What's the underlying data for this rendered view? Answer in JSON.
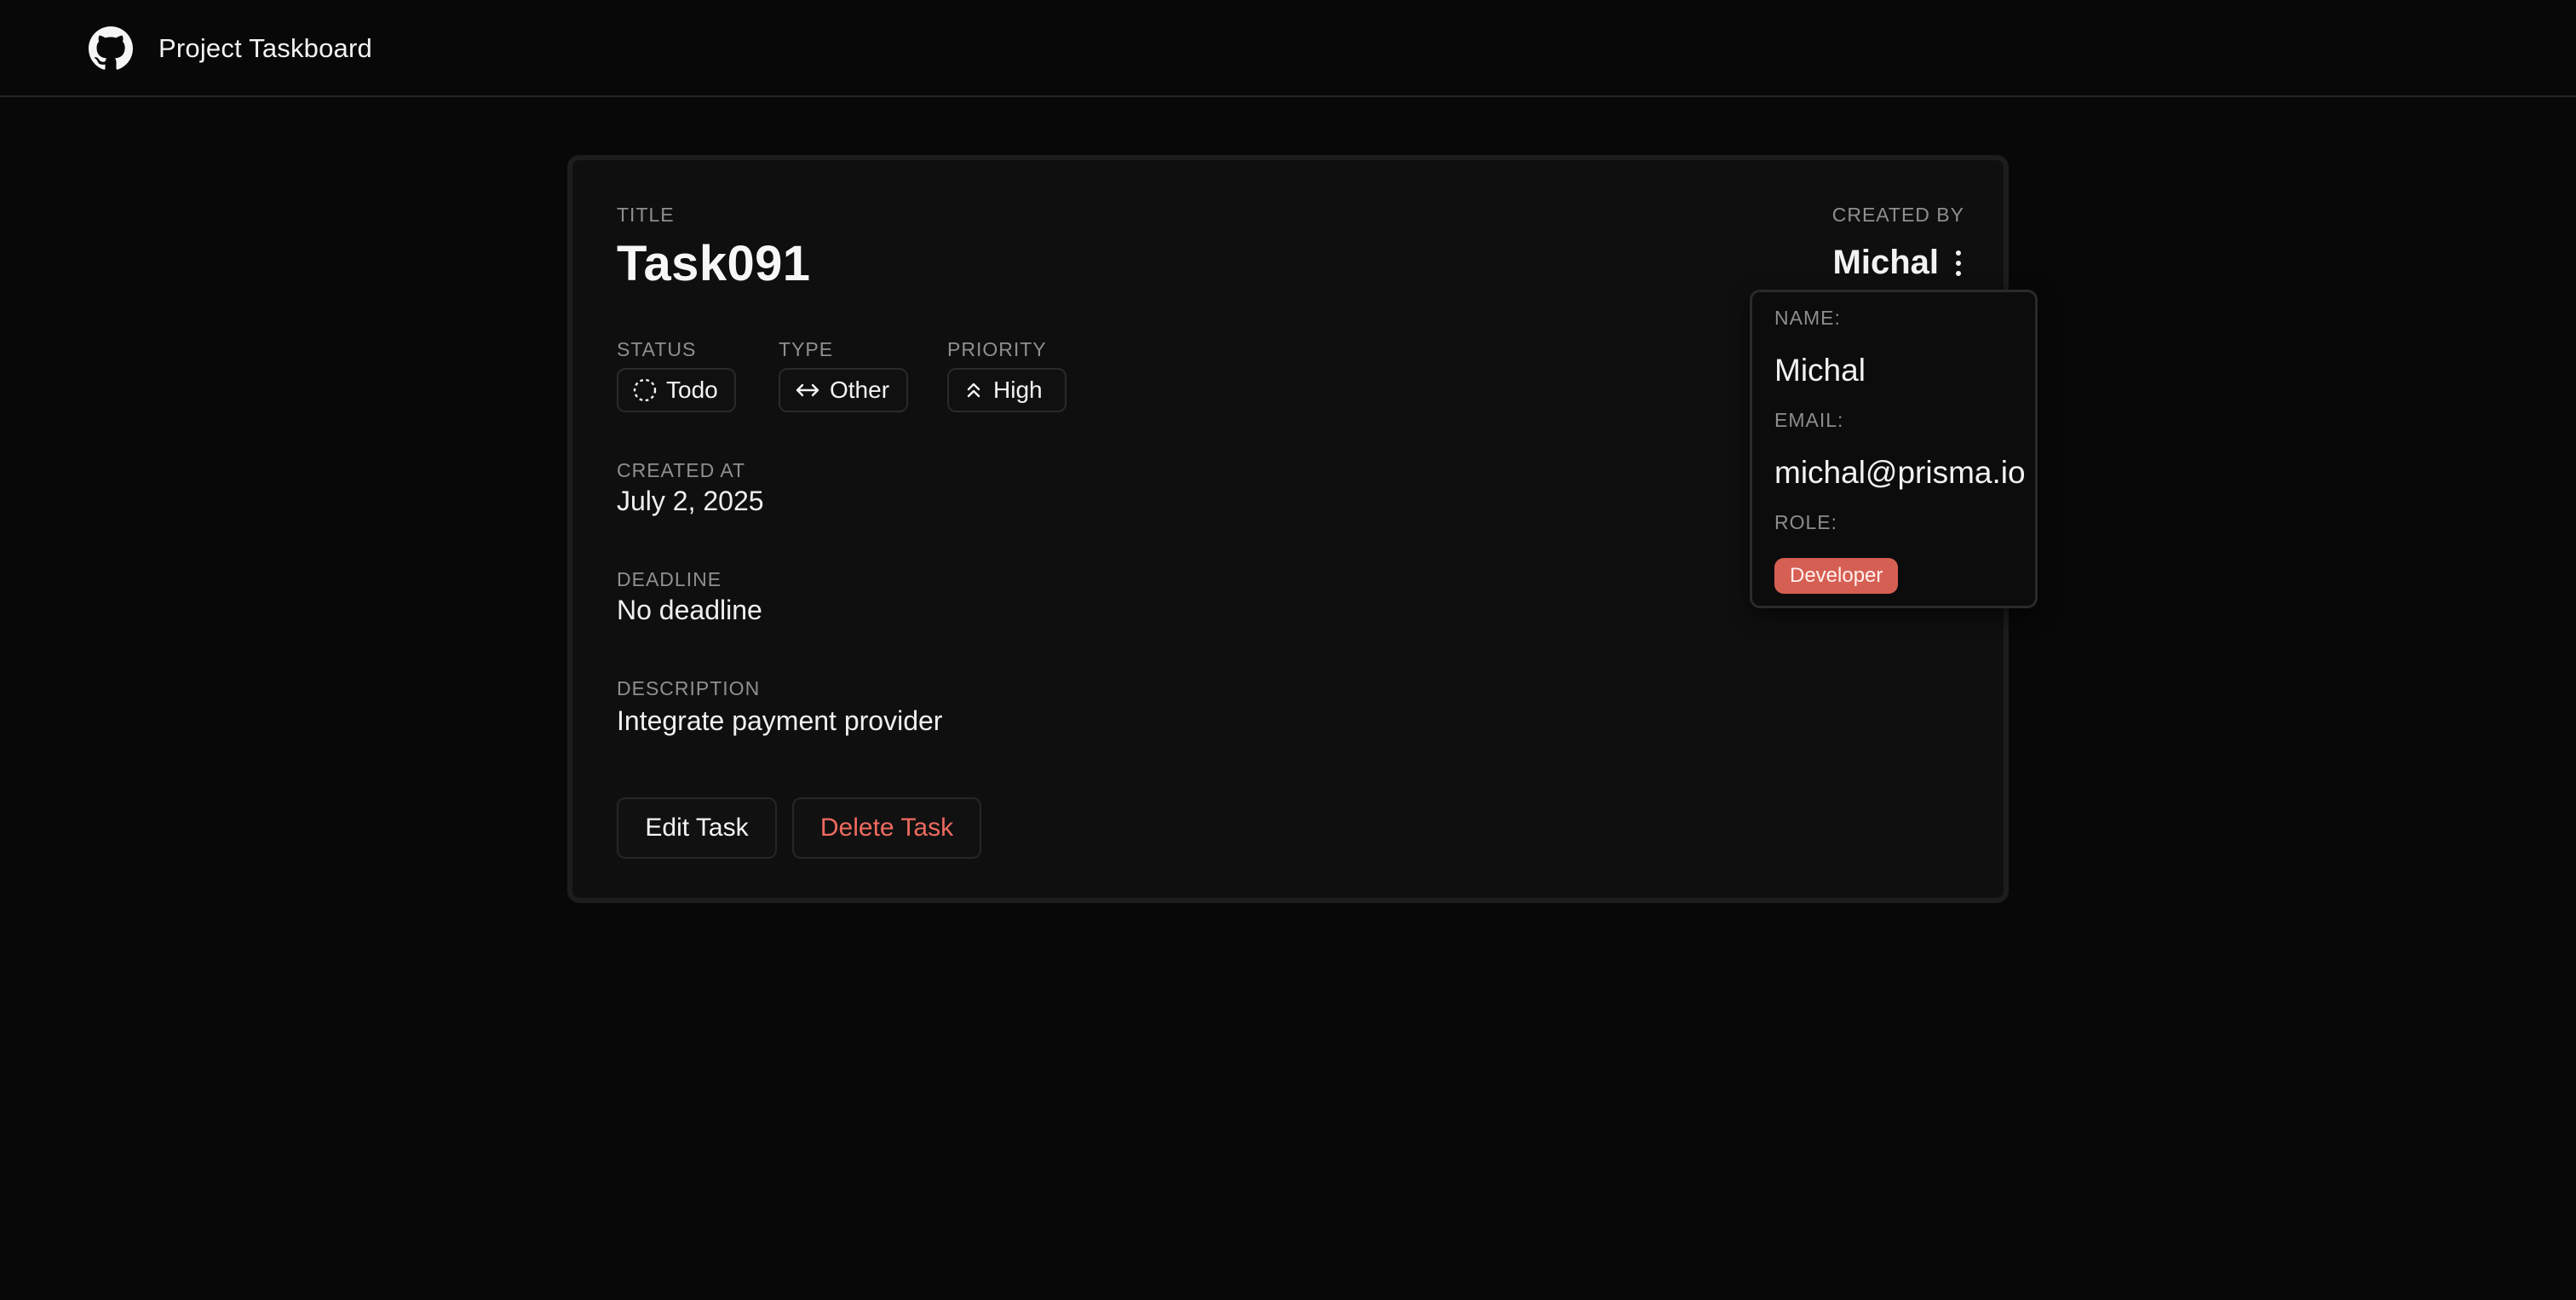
{
  "app": {
    "brand": "Project Taskboard",
    "logo_icon": "github-icon"
  },
  "task": {
    "title_label": "TITLE",
    "title": "Task091",
    "status_label": "STATUS",
    "status": "Todo",
    "status_icon": "dashed-circle-icon",
    "type_label": "TYPE",
    "type": "Other",
    "type_icon": "arrows-horizontal-icon",
    "priority_label": "PRIORITY",
    "priority": "High",
    "priority_icon": "chevrons-up-icon",
    "created_at_label": "CREATED AT",
    "created_at": "July 2, 2025",
    "deadline_label": "DEADLINE",
    "deadline": "No deadline",
    "description_label": "DESCRIPTION",
    "description": "Integrate payment provider",
    "created_by_label": "CREATED BY",
    "created_by": "Michal"
  },
  "actions": {
    "edit": "Edit Task",
    "delete": "Delete Task"
  },
  "creator_popover": {
    "name_label": "NAME:",
    "name": "Michal",
    "email_label": "EMAIL:",
    "email": "michal@prisma.io",
    "role_label": "ROLE:",
    "role": "Developer",
    "role_color": "#d65f54"
  },
  "colors": {
    "background": "#080808",
    "card": "#0f0f0f",
    "danger": "#ef6a5f"
  }
}
